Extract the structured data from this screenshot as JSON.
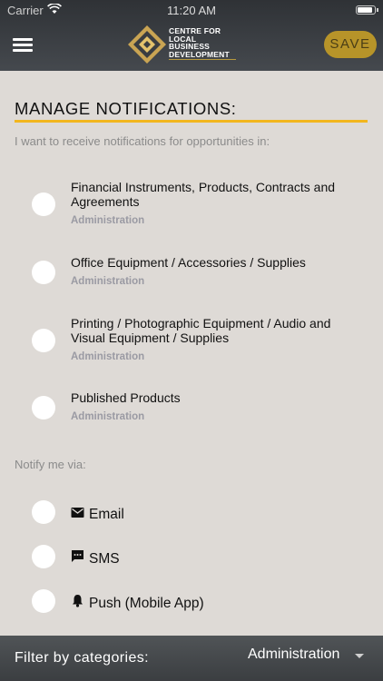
{
  "status_bar": {
    "carrier": "Carrier",
    "time": "11:20 AM"
  },
  "header": {
    "logo_lines": [
      "CENTRE FOR",
      "LOCAL",
      "BUSINESS",
      "DEVELOPMENT"
    ],
    "save_label": "SAVE",
    "accent": "#b79429"
  },
  "section": {
    "title": "MANAGE NOTIFICATIONS:",
    "intro": "I want to receive notifications for opportunities in:",
    "rule_color": "#f2b61f"
  },
  "opportunities": [
    {
      "title": "Financial Instruments, Products, Contracts and Agreements",
      "category": "Administration",
      "selected": false
    },
    {
      "title": "Office Equipment / Accessories / Supplies",
      "category": "Administration",
      "selected": false
    },
    {
      "title": "Printing / Photographic Equipment / Audio and Visual Equipment / Supplies",
      "category": "Administration",
      "selected": false
    },
    {
      "title": "Published Products",
      "category": "Administration",
      "selected": false
    }
  ],
  "notify": {
    "label": "Notify me via:",
    "channels": [
      {
        "label": "Email",
        "icon": "envelope-icon",
        "selected": false
      },
      {
        "label": "SMS",
        "icon": "chat-bubble-icon",
        "selected": false
      },
      {
        "label": "Push (Mobile App)",
        "icon": "bell-icon",
        "selected": false
      }
    ]
  },
  "footer": {
    "filter_label": "Filter by categories:",
    "selected_category": "Administration"
  }
}
